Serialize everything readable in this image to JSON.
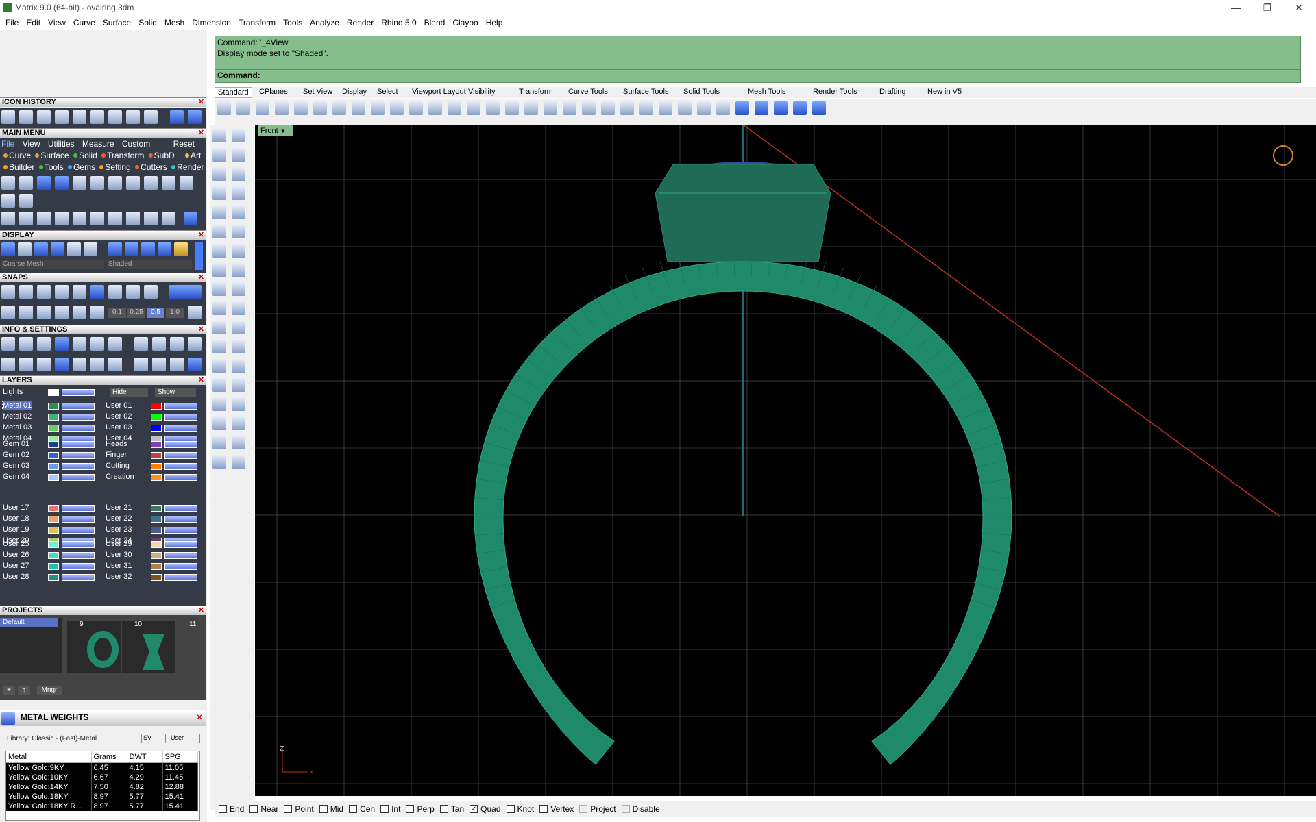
{
  "window": {
    "title": "Matrix 9.0 (64-bit) - ovalring.3dm",
    "min": "—",
    "max": "❐",
    "close": "✕"
  },
  "menu": [
    "File",
    "Edit",
    "View",
    "Curve",
    "Surface",
    "Solid",
    "Mesh",
    "Dimension",
    "Transform",
    "Tools",
    "Analyze",
    "Render",
    "Rhino 5.0",
    "Blend",
    "Clayoo",
    "Help"
  ],
  "command": {
    "line1": "Command: '_4View",
    "line2": "Display mode set to \"Shaded\".",
    "prompt": "Command:"
  },
  "tabs": [
    "Standard",
    "CPlanes",
    "Set View",
    "Display",
    "Select",
    "Viewport Layout",
    "Visibility",
    "Transform",
    "Curve Tools",
    "Surface Tools",
    "Solid Tools",
    "Mesh Tools",
    "Render Tools",
    "Drafting",
    "New in V5"
  ],
  "viewport": {
    "name": "Front",
    "axis_label_z": "Z",
    "axis_label_x": "x"
  },
  "panels": {
    "icon_history": "ICON HISTORY",
    "main_menu": "MAIN MENU",
    "display": "DISPLAY",
    "snaps": "SNAPS",
    "info": "INFO & SETTINGS",
    "layers": "LAYERS",
    "projects": "PROJECTS",
    "metal_weights": "METAL WEIGHTS"
  },
  "main_menu": {
    "row1": [
      "File",
      "View",
      "Utilities",
      "Measure",
      "Custom",
      "Reset"
    ],
    "row2": [
      {
        "label": "Curve",
        "color": "#f0a030"
      },
      {
        "label": "Surface",
        "color": "#f0a030"
      },
      {
        "label": "Solid",
        "color": "#40c040"
      },
      {
        "label": "Transform",
        "color": "#f06030"
      },
      {
        "label": "SubD",
        "color": "#f06030"
      },
      {
        "label": "Art",
        "color": "#f0c040"
      }
    ],
    "row3": [
      {
        "label": "Builder",
        "color": "#f0a030"
      },
      {
        "label": "Tools",
        "color": "#40c040"
      },
      {
        "label": "Gems",
        "color": "#40a0f0"
      },
      {
        "label": "Setting",
        "color": "#f0a030"
      },
      {
        "label": "Cutters",
        "color": "#f06030"
      },
      {
        "label": "Render",
        "color": "#40c0c0"
      }
    ]
  },
  "display": {
    "mesh": "Coarse Mesh",
    "mode": "Shaded"
  },
  "snaps": {
    "values": [
      "0.1",
      "0.25",
      "0.5",
      "1.0"
    ]
  },
  "layers": {
    "lights": "Lights",
    "hide": "Hide",
    "show": "Show",
    "left": [
      {
        "name": "Metal 01",
        "color": "#2e8b57"
      },
      {
        "name": "Metal 02",
        "color": "#3cb371"
      },
      {
        "name": "Metal 03",
        "color": "#66cc66"
      },
      {
        "name": "Metal 04",
        "color": "#99ee99"
      },
      {
        "name": "Gem 01",
        "color": "#1a3fa0"
      },
      {
        "name": "Gem 02",
        "color": "#2f62d0"
      },
      {
        "name": "Gem 03",
        "color": "#6a9af0"
      },
      {
        "name": "Gem 04",
        "color": "#a6c8ff"
      },
      {
        "name": "User 17",
        "color": "#f07070"
      },
      {
        "name": "User 18",
        "color": "#f0a070"
      },
      {
        "name": "User 19",
        "color": "#e0c060"
      },
      {
        "name": "User 20",
        "color": "#b0d060"
      },
      {
        "name": "User 25",
        "color": "#70f0d0"
      },
      {
        "name": "User 26",
        "color": "#40e0c0"
      },
      {
        "name": "User 27",
        "color": "#20c0b0"
      },
      {
        "name": "User 28",
        "color": "#209080"
      }
    ],
    "right": [
      {
        "name": "User 01",
        "color": "#ff0000"
      },
      {
        "name": "User 02",
        "color": "#00ff00"
      },
      {
        "name": "User 03",
        "color": "#0000ff"
      },
      {
        "name": "User 04",
        "color": "#c0c0c0"
      },
      {
        "name": "Heads",
        "color": "#8040c0"
      },
      {
        "name": "Finger",
        "color": "#c04040"
      },
      {
        "name": "Cutting",
        "color": "#ff8000"
      },
      {
        "name": "Creation",
        "color": "#ff9020"
      },
      {
        "name": "User 21",
        "color": "#3a7a5a"
      },
      {
        "name": "User 22",
        "color": "#3a7090"
      },
      {
        "name": "User 23",
        "color": "#4a5a8a"
      },
      {
        "name": "User 24",
        "color": "#6a3a6a"
      },
      {
        "name": "User 29",
        "color": "#f0d8b0"
      },
      {
        "name": "User 30",
        "color": "#d0b080"
      },
      {
        "name": "User 31",
        "color": "#b08050"
      },
      {
        "name": "User 32",
        "color": "#805020"
      }
    ]
  },
  "projects": {
    "folder": "Default",
    "items": [
      "9",
      "10",
      "11"
    ],
    "mngr": "Mngr"
  },
  "metal_weights": {
    "library": "Library: Classic - (Fast)-Metal",
    "sv": "SV",
    "user": "User",
    "headers": [
      "Metal",
      "Grams",
      "DWT",
      "SPG"
    ],
    "rows": [
      [
        "Yellow Gold:9KY",
        "6.45",
        "4.15",
        "11.05"
      ],
      [
        "Yellow Gold:10KY",
        "6.67",
        "4.29",
        "11.45"
      ],
      [
        "Yellow Gold:14KY",
        "7.50",
        "4.82",
        "12.88"
      ],
      [
        "Yellow Gold:18KY",
        "8.97",
        "5.77",
        "15.41"
      ],
      [
        "Yellow Gold:18KY R...",
        "8.97",
        "5.77",
        "15.41"
      ]
    ]
  },
  "osnaps": [
    {
      "label": "End",
      "checked": false
    },
    {
      "label": "Near",
      "checked": false
    },
    {
      "label": "Point",
      "checked": false
    },
    {
      "label": "Mid",
      "checked": false
    },
    {
      "label": "Cen",
      "checked": false
    },
    {
      "label": "Int",
      "checked": false
    },
    {
      "label": "Perp",
      "checked": false
    },
    {
      "label": "Tan",
      "checked": false
    },
    {
      "label": "Quad",
      "checked": true
    },
    {
      "label": "Knot",
      "checked": false
    },
    {
      "label": "Vertex",
      "checked": false
    },
    {
      "label": "Project",
      "checked": false
    },
    {
      "label": "Disable",
      "checked": false
    }
  ],
  "colors": {
    "command_bg": "#85bd8d",
    "ring": "#1f8a6a",
    "panel_bg": "#343a46",
    "axis_x": "#c03020",
    "axis_y": "#2a8aa0"
  }
}
